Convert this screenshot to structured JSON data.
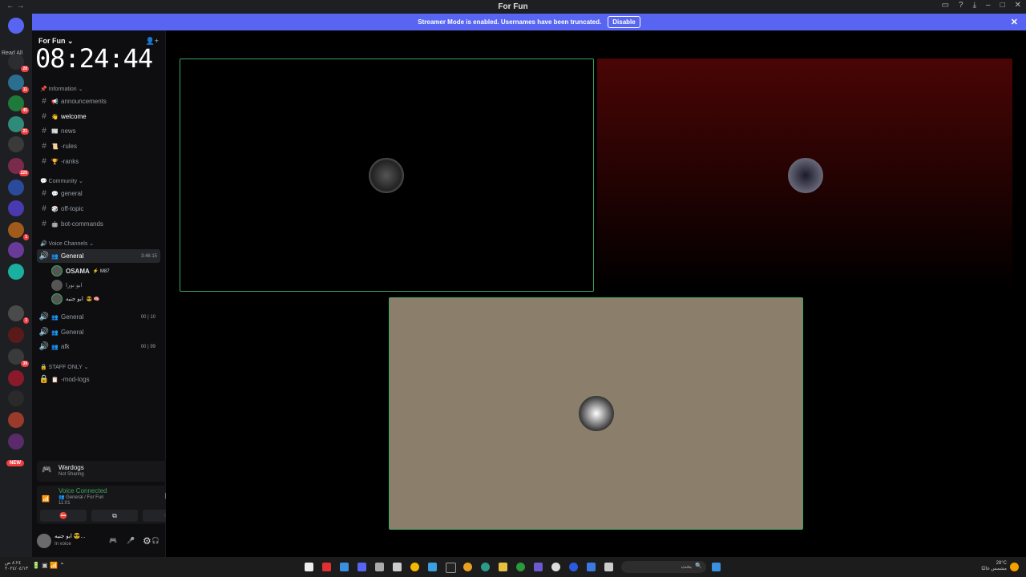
{
  "window": {
    "title": "For Fun"
  },
  "banner": {
    "text": "Streamer Mode is enabled. Usernames have been truncated.",
    "button": "Disable"
  },
  "servers": {
    "read_all": "Read All",
    "new_badge": "NEW",
    "badges": [
      "28",
      "11",
      "45",
      "21",
      "226",
      "1",
      "1",
      "39"
    ]
  },
  "sidebar": {
    "server_name": "For Fun",
    "clock": "08:24:44",
    "categories": {
      "information": "Information",
      "community": "Community",
      "voice": "Voice Channels",
      "staff": "STAFF ONLY"
    },
    "info_channels": [
      {
        "label": "announcements",
        "emoji": "📢"
      },
      {
        "label": "welcome",
        "emoji": "👋"
      },
      {
        "label": "news",
        "emoji": "📰"
      },
      {
        "label": "-rules",
        "emoji": "📜"
      },
      {
        "label": "-ranks",
        "emoji": "🏆"
      }
    ],
    "community_channels": [
      {
        "label": "general",
        "emoji": "💬"
      },
      {
        "label": "off-topic",
        "emoji": "🎲"
      },
      {
        "label": "bot-commands",
        "emoji": "🤖"
      }
    ],
    "voice_active": {
      "label": "General",
      "time": "3:46:15"
    },
    "members": [
      {
        "name": "OSAMA",
        "tag": "⚡ M87"
      },
      {
        "name": "ابو نورا",
        "tag": ""
      },
      {
        "name": "ابو جنيه",
        "tag": "😎 🧠"
      }
    ],
    "voice_channels": [
      {
        "label": "General",
        "count_a": "00",
        "count_b": "10"
      },
      {
        "label": "General",
        "count_a": "",
        "count_b": ""
      },
      {
        "label": "afk",
        "count_a": "00",
        "count_b": "99"
      }
    ],
    "staff_channels": [
      {
        "label": "-mod-logs",
        "emoji": "📋"
      }
    ]
  },
  "activity_panel": {
    "name": "Wardogs",
    "status": "Not Sharing"
  },
  "voice_panel": {
    "status": "Voice Connected",
    "channel": "General / For Fun",
    "time": "11:01"
  },
  "user_panel": {
    "name": "ابو جنيه 😎...",
    "status": "In voice"
  },
  "taskbar": {
    "search_text": "بحث",
    "time": "٨:٢٤ ص",
    "date": "٢٠٢٤/٠٤/١٣",
    "weather_temp": "28°C",
    "weather_desc": "مشمس غالبًا"
  },
  "colors": {
    "accent": "#5865f2",
    "speaking": "#3ba55d",
    "tile_red": "#4a0505",
    "tile_tan": "#8b7f6c"
  }
}
